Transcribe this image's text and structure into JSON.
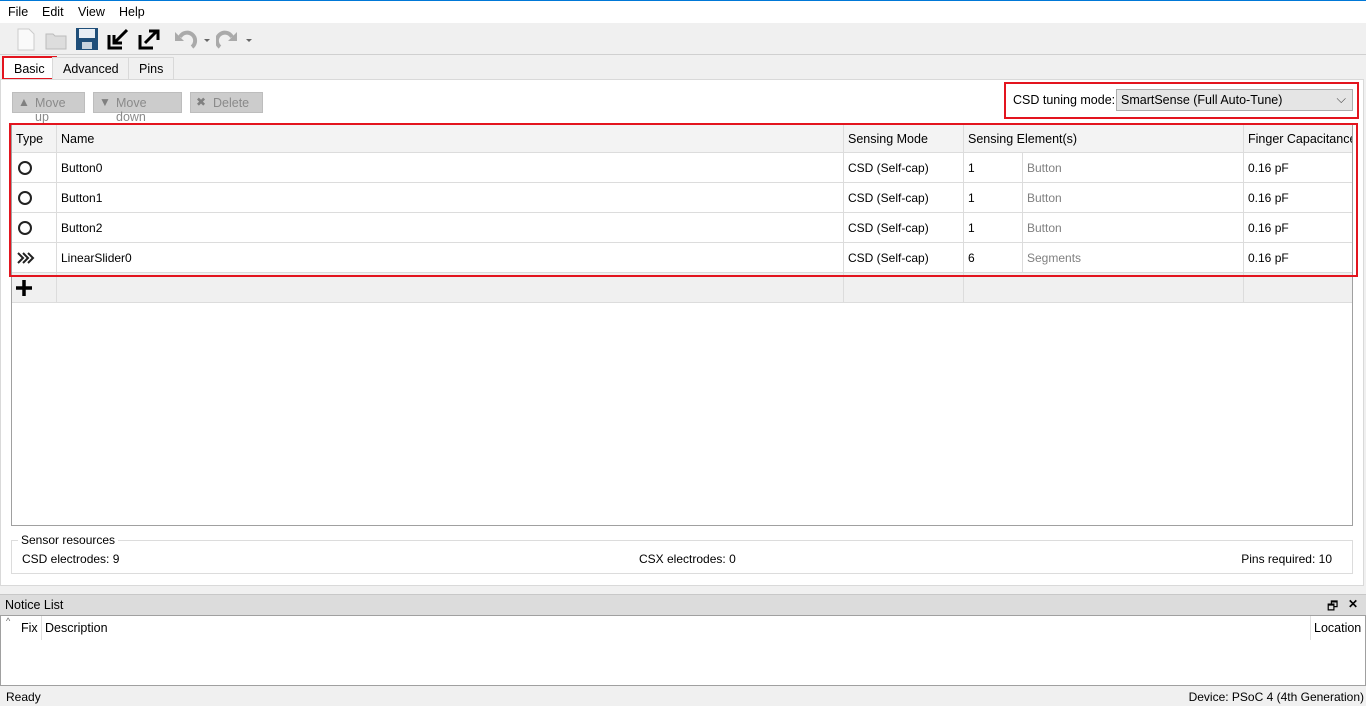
{
  "menu": [
    "File",
    "Edit",
    "View",
    "Help"
  ],
  "tabs": [
    "Basic",
    "Advanced",
    "Pins"
  ],
  "actions": {
    "move_up": "Move up",
    "move_down": "Move down",
    "delete": "Delete"
  },
  "tuning": {
    "label": "CSD tuning mode:",
    "value": "SmartSense (Full Auto-Tune)"
  },
  "table": {
    "headers": [
      "Type",
      "Name",
      "Sensing Mode",
      "Sensing Element(s)",
      "Finger Capacitance"
    ],
    "rows": [
      {
        "type_icon": "button-circle-icon",
        "name": "Button0",
        "mode": "CSD (Self-cap)",
        "count": "1",
        "element": "Button",
        "cap": "0.16 pF"
      },
      {
        "type_icon": "button-circle-icon",
        "name": "Button1",
        "mode": "CSD (Self-cap)",
        "count": "1",
        "element": "Button",
        "cap": "0.16 pF"
      },
      {
        "type_icon": "button-circle-icon",
        "name": "Button2",
        "mode": "CSD (Self-cap)",
        "count": "1",
        "element": "Button",
        "cap": "0.16 pF"
      },
      {
        "type_icon": "slider-chevron-icon",
        "name": "LinearSlider0",
        "mode": "CSD (Self-cap)",
        "count": "6",
        "element": "Segments",
        "cap": "0.16 pF"
      }
    ]
  },
  "resources": {
    "title": "Sensor resources",
    "csd_label": "CSD electrodes:",
    "csd": "9",
    "csx_label": "CSX electrodes:",
    "csx": "0",
    "pins_label": "Pins required:",
    "pins": "10"
  },
  "notice": {
    "title": "Notice List",
    "cols": [
      "Fix",
      "Description",
      "Location"
    ]
  },
  "status": {
    "left": "Ready",
    "right": "Device: PSoC 4 (4th Generation)"
  },
  "colors": {
    "highlight": "#e3141e",
    "accent": "#0078d7"
  }
}
